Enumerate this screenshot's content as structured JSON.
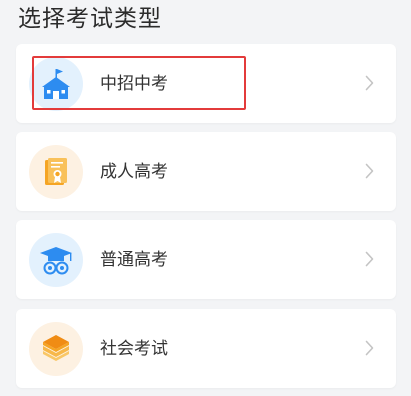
{
  "title": "选择考试类型",
  "options": [
    {
      "label": "中招中考",
      "icon": "school-building-icon",
      "selected": true
    },
    {
      "label": "成人高考",
      "icon": "certificate-book-icon",
      "selected": false
    },
    {
      "label": "普通高考",
      "icon": "graduation-cap-icon",
      "selected": false
    },
    {
      "label": "社会考试",
      "icon": "layers-stack-icon",
      "selected": false
    }
  ],
  "colors": {
    "icon_blue": "#2d8cf0",
    "icon_orange": "#f5a524",
    "highlight": "#e33b3b"
  }
}
